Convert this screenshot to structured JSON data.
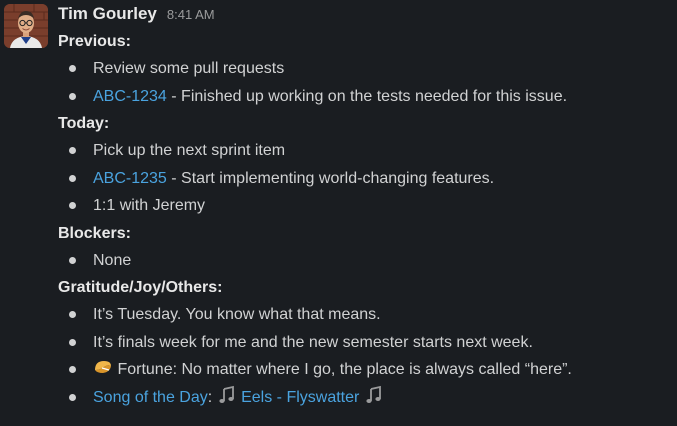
{
  "message": {
    "sender": "Tim Gourley",
    "timestamp": "8:41 AM",
    "sections": {
      "previous": {
        "heading": "Previous:",
        "item1": "Review some pull requests",
        "item2_link": "ABC-1234",
        "item2_text": " - Finished up working on the tests needed for this issue."
      },
      "today": {
        "heading": "Today:",
        "item1": "Pick up the next sprint item",
        "item2_link": "ABC-1235",
        "item2_text": " - Start implementing world-changing features.",
        "item3": "1:1 with Jeremy"
      },
      "blockers": {
        "heading": "Blockers:",
        "item1": "None"
      },
      "gratitude": {
        "heading": "Gratitude/Joy/Others:",
        "item1": "It’s Tuesday. You know what that means.",
        "item2": "It’s finals week for me and the new semester starts next week.",
        "item3_text": " Fortune: No matter where I go, the place is always called “here”.",
        "item3_icon": "fortune-cookie-icon",
        "item4_link": "Song of the Day",
        "item4_colon": ": ",
        "item4_song": "Eels - Flyswatter",
        "item4_icon": "musical-note-icon"
      }
    }
  },
  "colors": {
    "background": "#1a1d21",
    "text": "#d1d2d3",
    "heading": "#e8e8e8",
    "link": "#4aa3df",
    "timestamp": "#9a9b9c"
  }
}
